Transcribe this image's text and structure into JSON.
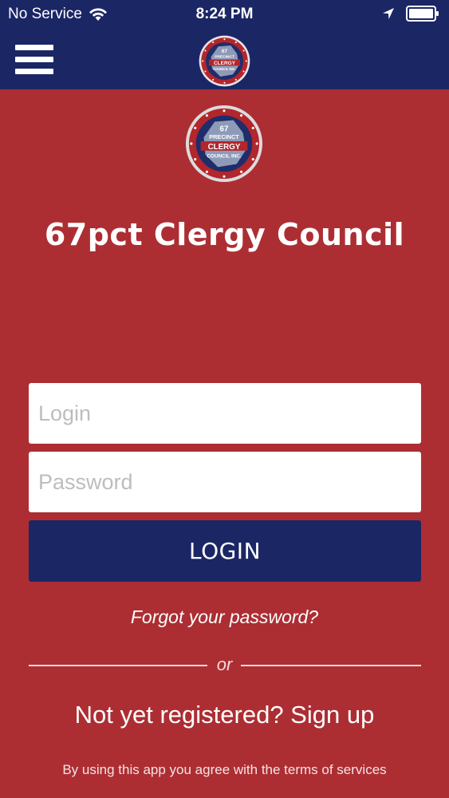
{
  "status_bar": {
    "carrier": "No Service",
    "time": "8:24 PM",
    "icons": [
      "wifi-icon",
      "location-icon",
      "battery-icon"
    ]
  },
  "header": {
    "menu_icon": "hamburger-menu-icon",
    "logo": "67-precinct-clergy-council-seal"
  },
  "logo_text": {
    "number": "67",
    "line1": "PRECINCT",
    "line2": "CLERGY",
    "line3": "COUNCIL INC."
  },
  "app": {
    "title": "67pct Clergy Council"
  },
  "form": {
    "login_placeholder": "Login",
    "login_value": "",
    "password_placeholder": "Password",
    "password_value": "",
    "login_button": "LOGIN",
    "forgot_password": "Forgot your password?",
    "divider": "or",
    "signup": "Not yet registered? Sign up",
    "terms": "By using this app you agree with the terms of services"
  },
  "colors": {
    "header_bg": "#1b2665",
    "page_bg": "#ac2e33",
    "button_bg": "#1b2665",
    "input_bg": "#ffffff"
  }
}
